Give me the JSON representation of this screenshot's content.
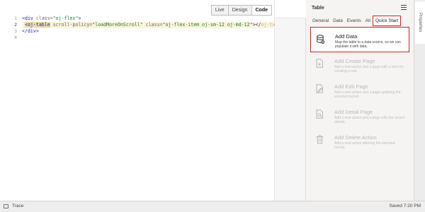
{
  "editor": {
    "views": [
      "Live",
      "Design",
      "Code"
    ],
    "active_view": "Code",
    "line_numbers": [
      "1",
      "2",
      "3",
      "4"
    ],
    "lines": [
      {
        "pre": "<",
        "tag": "div",
        "a1": " class=",
        "v1": "\"oj-flex\"",
        "post": ">"
      },
      {
        "indent": " ",
        "tag_hl": "<oj-table",
        "a1": " scroll-policy=",
        "v1": "\"loadMoreOnScroll\"",
        "a2": " class=",
        "v2": "\"oj-flex-item oj-sm-12 oj-md-12\"",
        "close": "></",
        "end_tag": "oj-table"
      },
      {
        "pre": "</",
        "tag": "div",
        "post": ">"
      },
      {
        "text": ""
      }
    ]
  },
  "panel": {
    "title": "Table",
    "menu_icon": "hamburger-menu-icon",
    "tabs": [
      "General",
      "Data",
      "Events",
      "All",
      "Quick Start"
    ],
    "active_tab": "Quick Start",
    "actions": [
      {
        "title": "Add Data",
        "desc": "Map the table to a data source, so we can populate it with data.",
        "icon": "database-icon",
        "enabled": true
      },
      {
        "title": "Add Create Page",
        "desc": "Add a new action and a page with a form for creating a row.",
        "icon": "add-page-icon",
        "enabled": false
      },
      {
        "title": "Add Edit Page",
        "desc": "Add a new action and a page updating the selected record.",
        "icon": "edit-page-icon",
        "enabled": false
      },
      {
        "title": "Add Detail Page",
        "desc": "Add a new action and a page with the record details.",
        "icon": "detail-page-icon",
        "enabled": false
      },
      {
        "title": "Add Delete Action",
        "desc": "Add a new action deleting the selected record.",
        "icon": "trash-icon",
        "enabled": false
      }
    ]
  },
  "rail": {
    "label": "Properties"
  },
  "status": {
    "trace": "Trace",
    "saved": "Saved 7:20 PM"
  },
  "colors": {
    "highlight": "#d81e1e",
    "tag": "#1a1aa6",
    "value": "#1a7f25"
  }
}
